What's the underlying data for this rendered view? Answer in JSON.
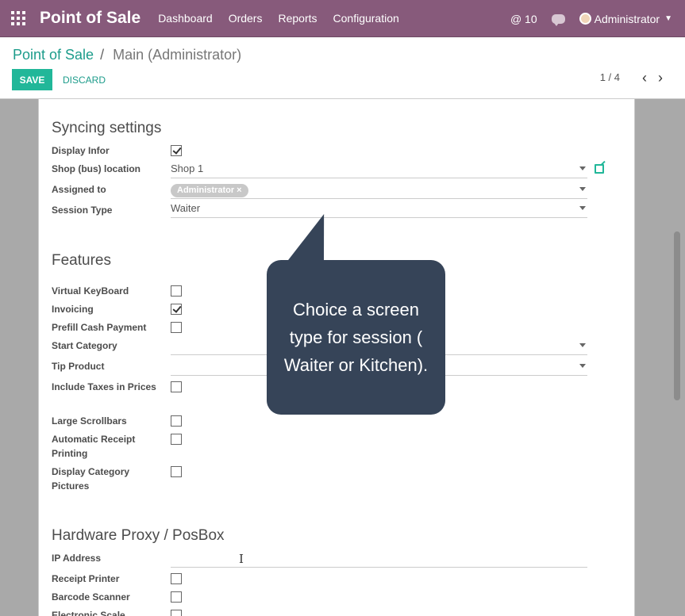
{
  "topbar": {
    "app_title": "Point of Sale",
    "menu": [
      "Dashboard",
      "Orders",
      "Reports",
      "Configuration"
    ],
    "activity_count": "@ 10",
    "user": "Administrator"
  },
  "control_panel": {
    "breadcrumb_parent": "Point of Sale",
    "breadcrumb_sep": "/",
    "breadcrumb_current": "Main (Administrator)",
    "save_label": "SAVE",
    "discard_label": "DISCARD",
    "pager_value": "1 / 4"
  },
  "syncing": {
    "title": "Syncing settings",
    "display_infor_label": "Display Infor",
    "display_infor_checked": true,
    "shop_location_label": "Shop (bus) location",
    "shop_location_value": "Shop 1",
    "assigned_to_label": "Assigned to",
    "assigned_tag": "Administrator ×",
    "session_type_label": "Session Type",
    "session_type_value": "Waiter"
  },
  "features": {
    "title": "Features",
    "virtual_keyboard": "Virtual KeyBoard",
    "invoicing": "Invoicing",
    "prefill_cash": "Prefill Cash Payment",
    "start_category": "Start Category",
    "tip_product": "Tip Product",
    "include_taxes": "Include Taxes in Prices",
    "large_scrollbars": "Large Scrollbars",
    "auto_receipt_line1": "Automatic Receipt",
    "auto_receipt_line2": "Printing",
    "display_cat_line1": "Display Category",
    "display_cat_line2": "Pictures"
  },
  "hardware": {
    "title": "Hardware Proxy / PosBox",
    "ip_address": "IP Address",
    "receipt_printer": "Receipt Printer",
    "barcode_scanner": "Barcode Scanner",
    "electronic_scale": "Electronic Scale"
  },
  "tooltip": {
    "text": "Choice a screen type for session ( Waiter or Kitchen)."
  },
  "colors": {
    "topbar": "#875a7b",
    "accent": "#21b799",
    "tooltip_bg": "#364458"
  }
}
